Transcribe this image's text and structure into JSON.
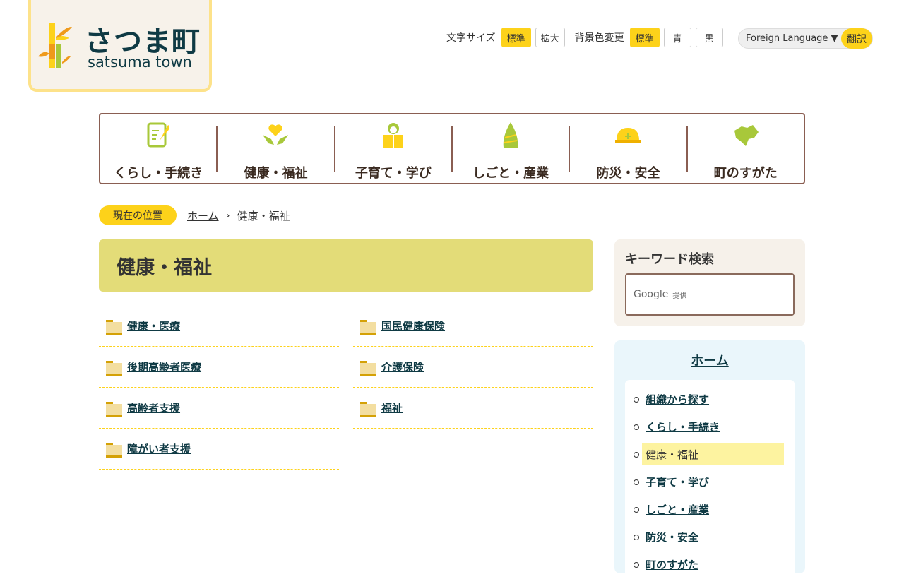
{
  "logo": {
    "jp": "さつま町",
    "en": "satsuma town"
  },
  "tools": {
    "font_label": "文字サイズ",
    "font_std": "標準",
    "font_large": "拡大",
    "bg_label": "背景色変更",
    "bg_std": "標準",
    "bg_blue": "青",
    "bg_black": "黒"
  },
  "lang": {
    "select": "Foreign Language ▼",
    "translate": "翻訳"
  },
  "gnav": [
    {
      "label": "くらし・手続き",
      "icon": "document-pen-icon"
    },
    {
      "label": "健康・福祉",
      "icon": "hands-heart-icon"
    },
    {
      "label": "子育て・学び",
      "icon": "child-book-icon"
    },
    {
      "label": "しごと・産業",
      "icon": "bamboo-shoot-icon"
    },
    {
      "label": "防災・安全",
      "icon": "helmet-icon"
    },
    {
      "label": "町のすがた",
      "icon": "town-map-icon"
    }
  ],
  "breadcrumb": {
    "here": "現在の位置",
    "home": "ホーム",
    "sep": "›",
    "current": "健康・福祉"
  },
  "page_title": "健康・福祉",
  "categories": [
    "健康・医療",
    "国民健康保険",
    "後期高齢者医療",
    "介護保険",
    "高齢者支援",
    "福祉",
    "障がい者支援"
  ],
  "keyword": {
    "title": "キーワード検索",
    "google": "Google",
    "provided": "提供"
  },
  "side": {
    "title": "ホーム",
    "items": [
      "組織から探す",
      "くらし・手続き",
      "健康・福祉",
      "子育て・学び",
      "しごと・産業",
      "防災・安全",
      "町のすがた"
    ]
  },
  "colors": {
    "accent": "#fdd21a",
    "brown": "#8a5e52",
    "title_bg": "#e3dc78"
  }
}
